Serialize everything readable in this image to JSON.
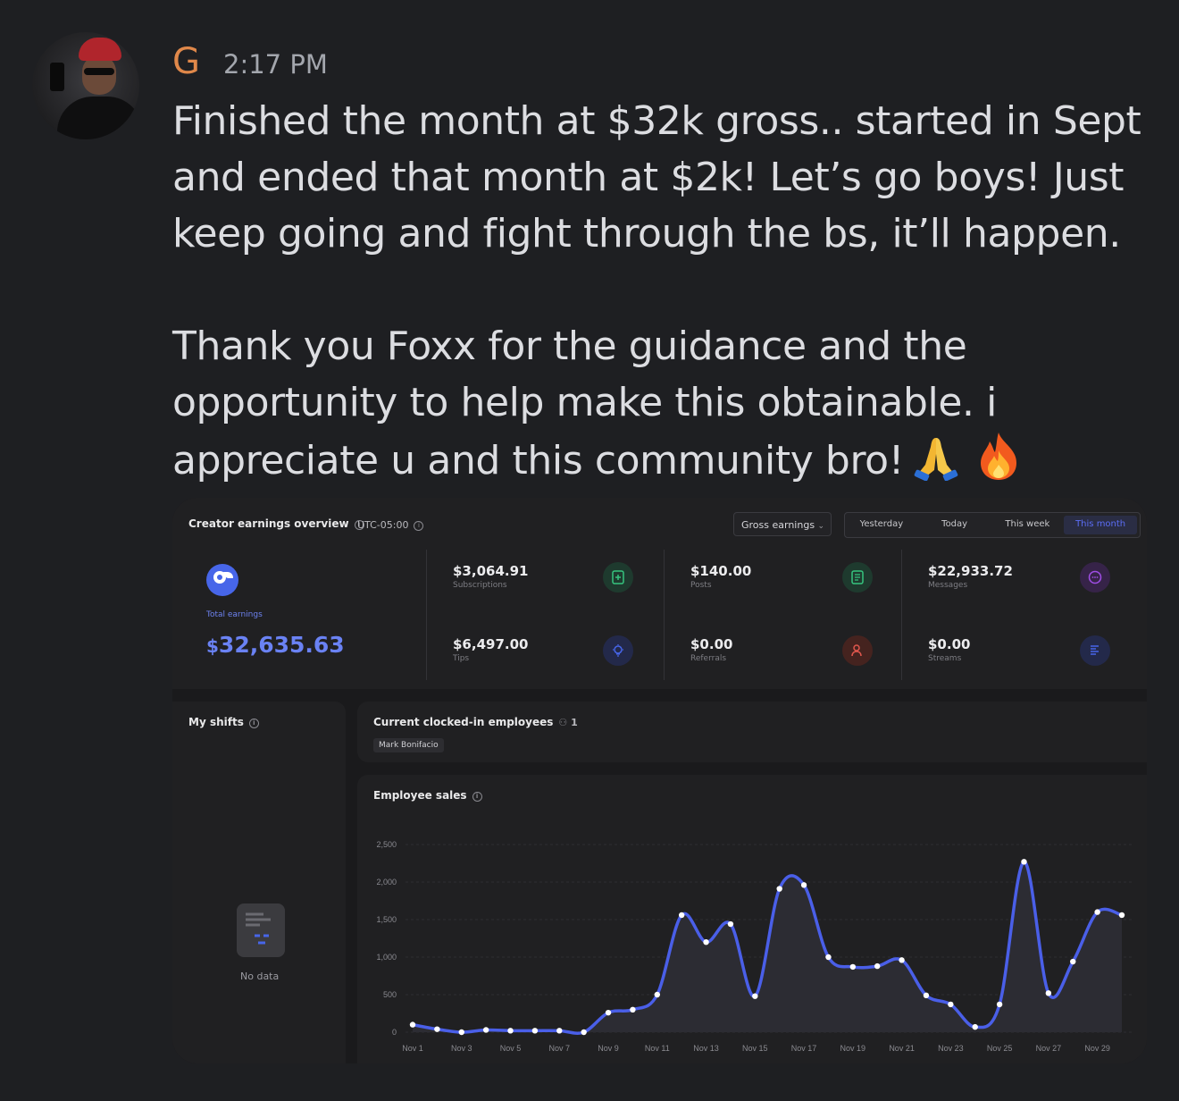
{
  "message": {
    "username": "G",
    "timestamp": "2:17 PM",
    "paragraph_1": "Finished the month at $32k gross.. started in Sept and ended that month at $2k! Let’s go boys! Just keep going and fight through the bs, it’ll happen.",
    "paragraph_2": "Thank you Foxx for the guidance and the opportunity to help make this obtainable. i appreciate u and this community bro!",
    "emojis": [
      "folded-hands",
      "fire"
    ]
  },
  "dashboard": {
    "title": "Creator earnings overview",
    "timezone": "UTC-05:00",
    "dropdown_label": "Gross earnings",
    "tabs": [
      "Yesterday",
      "Today",
      "This week",
      "This month"
    ],
    "active_tab": "This month",
    "total_label": "Total earnings",
    "total_currency": "$",
    "total_value": "32,635.63",
    "stats": [
      {
        "value": "$3,064.91",
        "label": "Subscriptions",
        "icon": "subscription-icon",
        "color": "#36c47f"
      },
      {
        "value": "$140.00",
        "label": "Posts",
        "icon": "posts-icon",
        "color": "#36c47f"
      },
      {
        "value": "$22,933.72",
        "label": "Messages",
        "icon": "messages-icon",
        "color": "#a04ee6"
      },
      {
        "value": "$6,497.00",
        "label": "Tips",
        "icon": "tips-icon",
        "color": "#4766e9"
      },
      {
        "value": "$0.00",
        "label": "Referrals",
        "icon": "referrals-icon",
        "color": "#e0574d"
      },
      {
        "value": "$0.00",
        "label": "Streams",
        "icon": "streams-icon",
        "color": "#4766e9"
      }
    ],
    "shifts_title": "My shifts",
    "no_data": "No data",
    "clocked_title": "Current clocked-in employees",
    "clocked_count": "1",
    "clocked_employee": "Mark Bonifacio",
    "sales_title": "Employee sales"
  },
  "chart_data": {
    "type": "area",
    "yticks": [
      "2,500",
      "2,000",
      "1,500",
      "1,000",
      "500",
      "0"
    ],
    "ylim": [
      0,
      2500
    ],
    "xlabels": [
      "Nov 1",
      "Nov 3",
      "Nov 5",
      "Nov 7",
      "Nov 9",
      "Nov 11",
      "Nov 13",
      "Nov 15",
      "Nov 17",
      "Nov 19",
      "Nov 21",
      "Nov 23",
      "Nov 25",
      "Nov 27",
      "Nov 29"
    ],
    "x": [
      1,
      2,
      3,
      4,
      5,
      6,
      7,
      8,
      9,
      10,
      11,
      12,
      13,
      14,
      15,
      16,
      17,
      18,
      19,
      20,
      21,
      22,
      23,
      24,
      25,
      26,
      27,
      28,
      29,
      30
    ],
    "values": [
      100,
      40,
      0,
      30,
      20,
      20,
      20,
      0,
      260,
      300,
      500,
      1560,
      1200,
      1440,
      480,
      1910,
      1960,
      1000,
      870,
      880,
      960,
      490,
      370,
      70,
      370,
      2270,
      520,
      940,
      1600,
      1560
    ],
    "color": "#4a5fe8"
  }
}
